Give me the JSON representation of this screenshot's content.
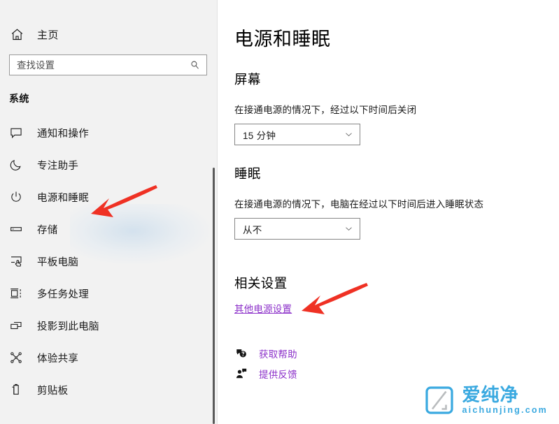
{
  "sidebar": {
    "home": {
      "label": "主页",
      "icon": "home-icon"
    },
    "search": {
      "placeholder": "查找设置",
      "value": "",
      "icon": "search-icon"
    },
    "group_title": "系统",
    "items": [
      {
        "label": "通知和操作",
        "icon": "notification-icon"
      },
      {
        "label": "专注助手",
        "icon": "moon-icon"
      },
      {
        "label": "电源和睡眠",
        "icon": "power-icon"
      },
      {
        "label": "存储",
        "icon": "storage-icon"
      },
      {
        "label": "平板电脑",
        "icon": "tablet-icon"
      },
      {
        "label": "多任务处理",
        "icon": "multitasking-icon"
      },
      {
        "label": "投影到此电脑",
        "icon": "project-icon"
      },
      {
        "label": "体验共享",
        "icon": "share-icon"
      },
      {
        "label": "剪贴板",
        "icon": "clipboard-icon"
      }
    ]
  },
  "main": {
    "title": "电源和睡眠",
    "screen": {
      "heading": "屏幕",
      "description": "在接通电源的情况下，经过以下时间后关闭",
      "dropdown_value": "15 分钟"
    },
    "sleep": {
      "heading": "睡眠",
      "description": "在接通电源的情况下，电脑在经过以下时间后进入睡眠状态",
      "dropdown_value": "从不"
    },
    "related": {
      "heading": "相关设置",
      "link": "其他电源设置"
    },
    "help": [
      {
        "label": "获取帮助",
        "icon": "question-bubble-icon"
      },
      {
        "label": "提供反馈",
        "icon": "feedback-person-icon"
      }
    ]
  },
  "watermark": {
    "cn": "爱纯净",
    "en": "aichunjing.com"
  },
  "colors": {
    "accent_link": "#8b2fc9",
    "arrow_red": "#ef3124",
    "sidebar_bg": "#f2f2f2",
    "watermark_blue": "#3aa9e0"
  }
}
